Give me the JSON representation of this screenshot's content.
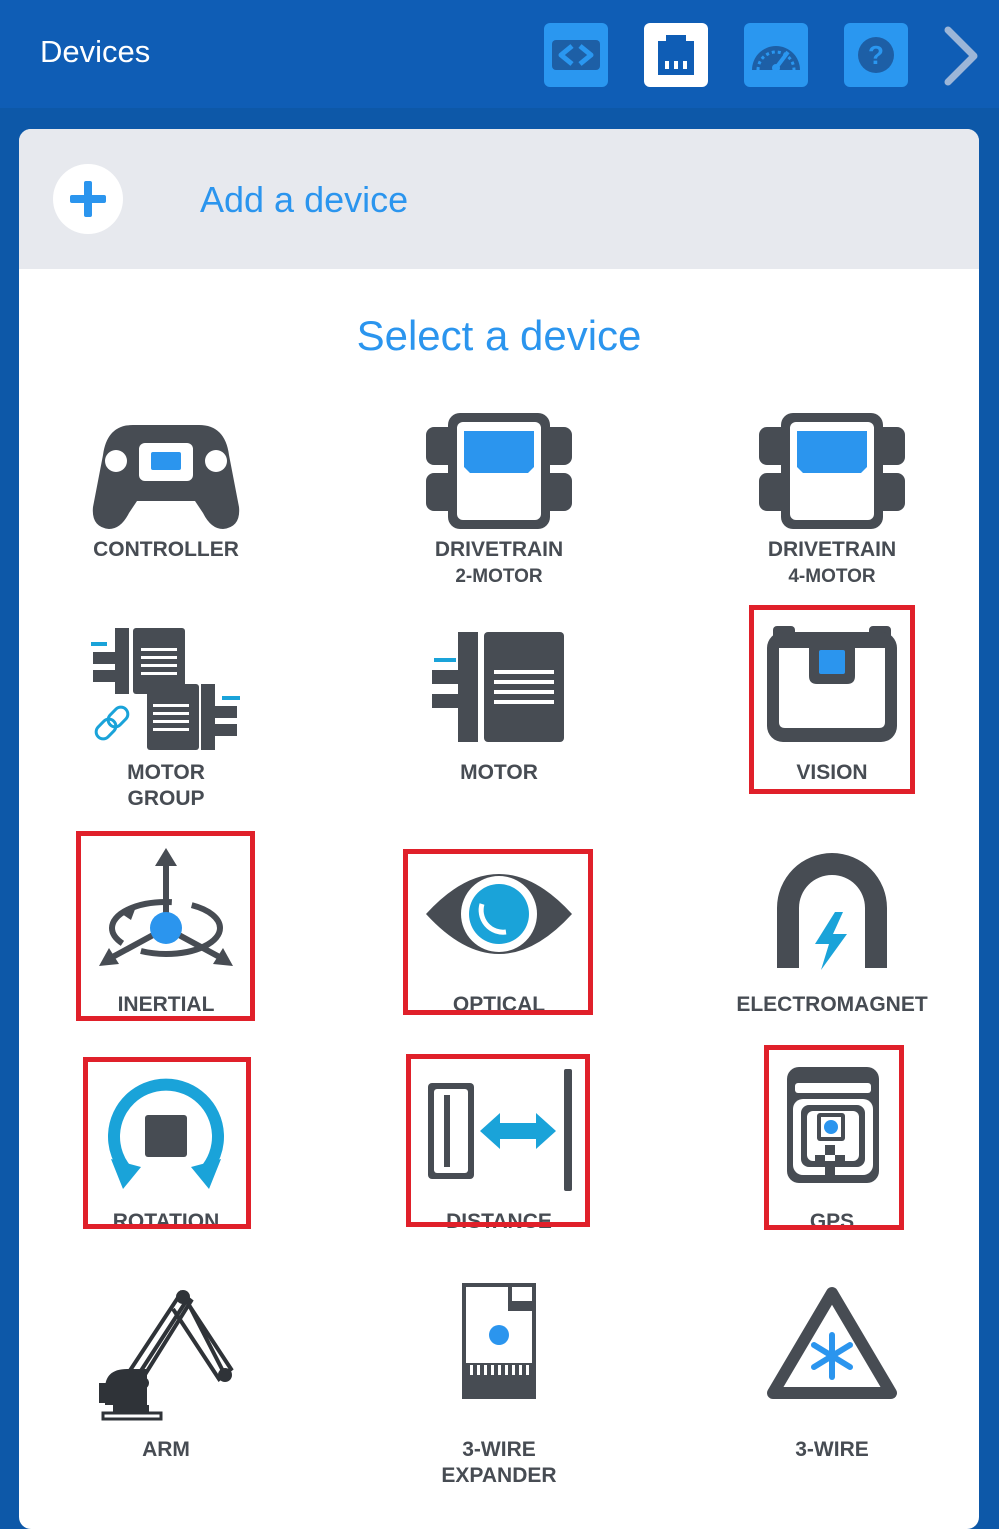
{
  "header": {
    "title": "Devices",
    "buttons": [
      {
        "name": "code-view-button",
        "icon": "code-brackets-icon"
      },
      {
        "name": "devices-button",
        "icon": "port-icon",
        "active": true
      },
      {
        "name": "dashboard-button",
        "icon": "speedometer-icon"
      },
      {
        "name": "help-button",
        "icon": "help-icon"
      }
    ],
    "next_icon": "chevron-right-icon"
  },
  "add": {
    "label": "Add a device",
    "icon": "plus-icon"
  },
  "select_title": "Select a device",
  "devices": {
    "controller": {
      "label": "CONTROLLER",
      "icon": "gamepad-icon"
    },
    "drivetrain2": {
      "label": "DRIVETRAIN",
      "sub": "2-MOTOR",
      "icon": "drivetrain-icon"
    },
    "drivetrain4": {
      "label": "DRIVETRAIN",
      "sub": "4-MOTOR",
      "icon": "drivetrain-icon"
    },
    "motorgroup": {
      "label": "MOTOR",
      "sub": "GROUP",
      "icon": "motor-group-icon"
    },
    "motor": {
      "label": "MOTOR",
      "icon": "motor-icon"
    },
    "vision": {
      "label": "VISION",
      "icon": "vision-sensor-icon",
      "highlighted": true
    },
    "inertial": {
      "label": "INERTIAL",
      "icon": "inertial-axes-icon",
      "highlighted": true
    },
    "optical": {
      "label": "OPTICAL",
      "icon": "eye-icon",
      "highlighted": true
    },
    "electromagnet": {
      "label": "ELECTROMAGNET",
      "icon": "magnet-icon"
    },
    "rotation": {
      "label": "ROTATION",
      "icon": "rotation-icon",
      "highlighted": true
    },
    "distance": {
      "label": "DISTANCE",
      "icon": "distance-icon",
      "highlighted": true
    },
    "gps": {
      "label": "GPS",
      "icon": "gps-sensor-icon",
      "highlighted": true
    },
    "arm": {
      "label": "ARM",
      "icon": "robot-arm-icon"
    },
    "expander": {
      "label": "3-WIRE",
      "sub": "EXPANDER",
      "icon": "expander-icon"
    },
    "threewire": {
      "label": "3-WIRE",
      "icon": "triangle-asterisk-icon"
    }
  },
  "colors": {
    "header_bg": "#0f5db5",
    "accent_blue": "#2b95ee",
    "icon_dark": "#474c53",
    "cyan": "#1aa3d9",
    "highlight": "#e0202a"
  }
}
